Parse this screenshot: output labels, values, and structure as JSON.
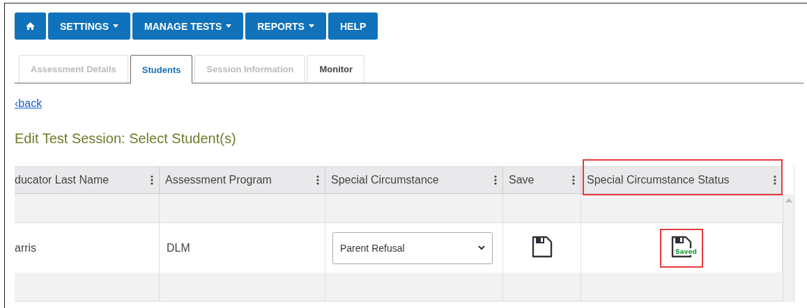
{
  "nav": [
    {
      "kind": "home"
    },
    {
      "kind": "menu",
      "label": "SETTINGS"
    },
    {
      "kind": "menu",
      "label": "MANAGE TESTS"
    },
    {
      "kind": "menu",
      "label": "REPORTS"
    },
    {
      "kind": "link",
      "label": "HELP"
    }
  ],
  "tabs": [
    {
      "label": "Assessment Details",
      "selected": false,
      "disabled": true
    },
    {
      "label": "Students",
      "selected": true,
      "disabled": false
    },
    {
      "label": "Session Information",
      "selected": false,
      "disabled": true
    },
    {
      "label": "Monitor",
      "selected": false,
      "disabled": false
    }
  ],
  "back_link": "‹back",
  "heading": "Edit Test Session: Select Student(s)",
  "table": {
    "columns": [
      {
        "label": "ducator Last Name",
        "highlighted": false
      },
      {
        "label": "Assessment Program",
        "highlighted": false
      },
      {
        "label": "Special Circumstance",
        "highlighted": false
      },
      {
        "label": "Save",
        "highlighted": false
      },
      {
        "label": "Special Circumstance Status",
        "highlighted": true
      }
    ],
    "rows": [
      {
        "kind": "blank"
      },
      {
        "kind": "data",
        "educator": "arris",
        "program": "DLM",
        "special_circumstance": "Parent Refusal",
        "status": "Saved",
        "status_highlighted": true
      },
      {
        "kind": "blank"
      }
    ]
  }
}
